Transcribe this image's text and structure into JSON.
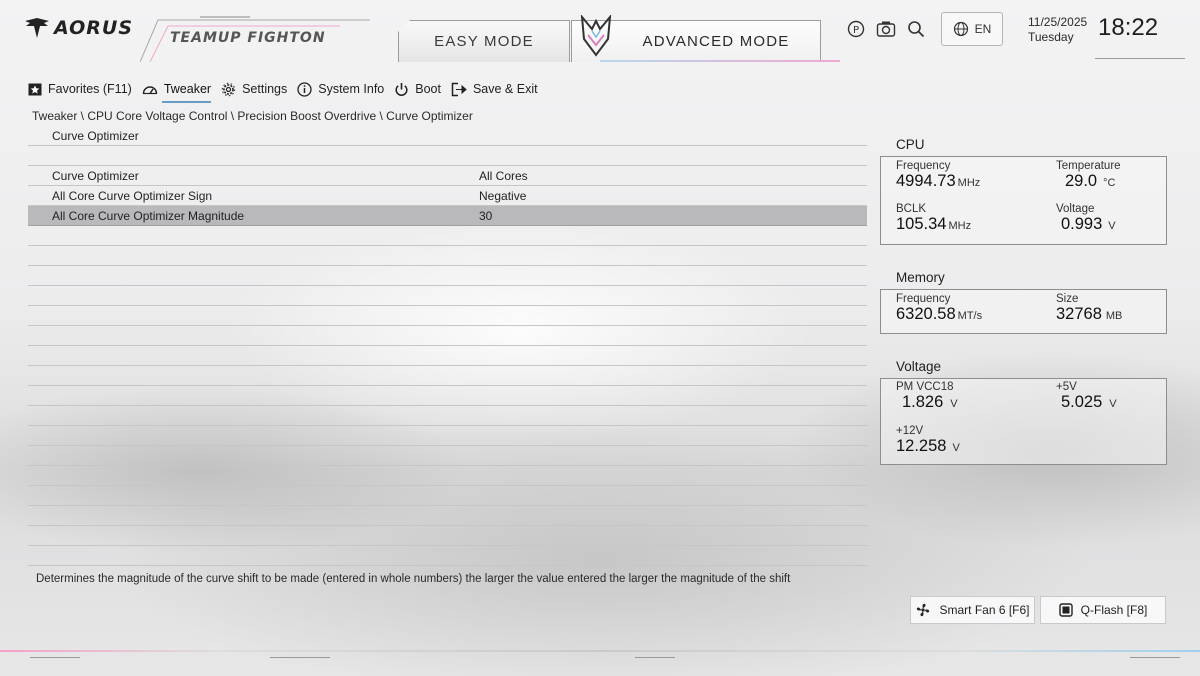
{
  "header": {
    "logo_text": "AORUS",
    "team_text": "TEAMUP FIGHTON",
    "easy_mode_label": "EASY MODE",
    "advanced_mode_label": "ADVANCED MODE",
    "language": "EN",
    "date": "11/25/2025",
    "weekday": "Tuesday",
    "time": "18:22",
    "icons": [
      "help-icon",
      "screenshot-icon",
      "search-icon",
      "globe-icon"
    ]
  },
  "menu": {
    "items": [
      {
        "label": "Favorites (F11)",
        "icon": "star-icon"
      },
      {
        "label": "Tweaker",
        "icon": "speedometer-icon",
        "active": true
      },
      {
        "label": "Settings",
        "icon": "gear-icon"
      },
      {
        "label": "System Info",
        "icon": "info-icon"
      },
      {
        "label": "Boot",
        "icon": "power-icon"
      },
      {
        "label": "Save & Exit",
        "icon": "exit-icon"
      }
    ]
  },
  "breadcrumb": "Tweaker \\ CPU Core Voltage Control \\ Precision Boost Overdrive \\ Curve Optimizer",
  "settings": {
    "section_title": "Curve Optimizer",
    "rows": [
      {
        "label": "Curve Optimizer",
        "value": "All Cores"
      },
      {
        "label": "All Core Curve Optimizer Sign",
        "value": "Negative"
      },
      {
        "label": "All Core Curve Optimizer Magnitude",
        "value": "30",
        "selected": true
      }
    ]
  },
  "help_text": "Determines the magnitude of the curve shift to be made (entered in whole numbers) the larger the value entered the larger the magnitude of the shift",
  "cpu": {
    "title": "CPU",
    "frequency_label": "Frequency",
    "frequency_value": "4994.73",
    "frequency_unit": "MHz",
    "temperature_label": "Temperature",
    "temperature_value": "29.0",
    "temperature_unit": "°C",
    "bclk_label": "BCLK",
    "bclk_value": "105.34",
    "bclk_unit": "MHz",
    "voltage_label": "Voltage",
    "voltage_value": "0.993",
    "voltage_unit": "V"
  },
  "memory": {
    "title": "Memory",
    "frequency_label": "Frequency",
    "frequency_value": "6320.58",
    "frequency_unit": "MT/s",
    "size_label": "Size",
    "size_value": "32768",
    "size_unit": "MB"
  },
  "voltage": {
    "title": "Voltage",
    "pmvcc18_label": "PM VCC18",
    "pmvcc18_value": "1.826",
    "pmvcc18_unit": "V",
    "p5v_label": "+5V",
    "p5v_value": "5.025",
    "p5v_unit": "V",
    "p12v_label": "+12V",
    "p12v_value": "12.258",
    "p12v_unit": "V"
  },
  "buttons": {
    "smart_fan": "Smart Fan 6 [F6]",
    "qflash": "Q-Flash [F8]"
  },
  "colors": {
    "accent_pink": "#f0a8cf",
    "accent_blue": "#9fd0ef",
    "selected_row": "#b9b9bb"
  }
}
